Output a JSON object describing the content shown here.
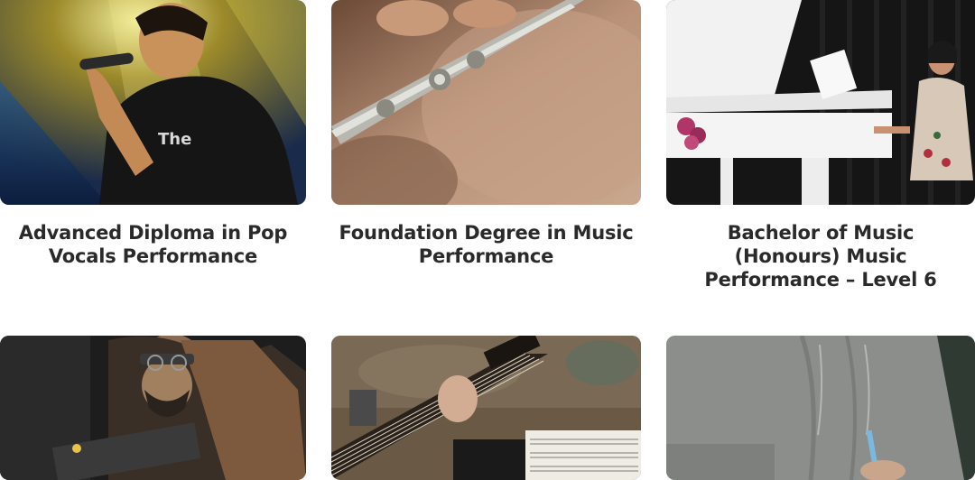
{
  "courses": [
    {
      "title": "Advanced Diploma in Pop Vocals Performance",
      "image": "pop-vocalist-on-stage-photo"
    },
    {
      "title": "Foundation Degree in Music Performance",
      "image": "flute-player-photo"
    },
    {
      "title": "Bachelor of Music (Honours) Music Performance – Level 6",
      "image": "pianist-at-grand-piano-photo"
    },
    {
      "title": "",
      "image": "guitarist-in-jacket-photo"
    },
    {
      "title": "",
      "image": "guitar-and-sheet-music-photo"
    },
    {
      "title": "",
      "image": "student-writing-in-hoodie-photo"
    }
  ],
  "colors": {
    "title_text": "#2a2a2a",
    "background": "#ffffff"
  }
}
